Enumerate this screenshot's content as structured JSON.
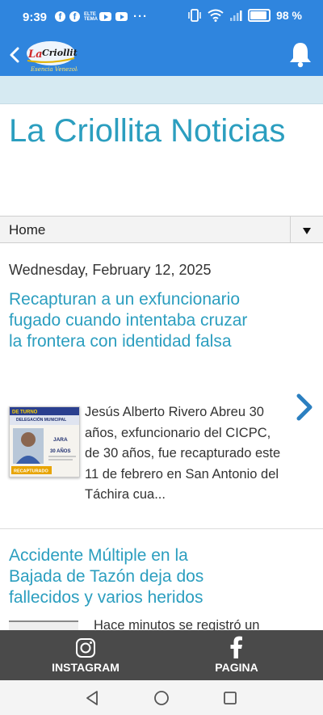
{
  "status_bar": {
    "time": "9:39",
    "tiny_icon_text": "ELTE TEMA",
    "more": "···",
    "battery": "98 %"
  },
  "header": {
    "logo_text": "La Criollita",
    "logo_tagline": "Esencia Venezolana",
    "back_icon": "chevron-left-icon",
    "bell_icon": "bell-icon"
  },
  "blog": {
    "title": "La Criollita Noticias"
  },
  "nav": {
    "home": "Home"
  },
  "posts": {
    "date": "Wednesday, February 12, 2025",
    "items": [
      {
        "title": "Recapturan a un exfuncionario fugado cuando intentaba cruzar la frontera con identidad falsa",
        "snippet": "  Jesús Alberto Rivero Abreu 30 años, exfuncionario del CICPC, de 30 años, fue recapturado este 11 de febrero en San Antonio del Táchira cua...",
        "thumb": {
          "top_label": "DE TURNO",
          "header": "DELEGACIÓN MUNICIPAL",
          "sub": "JARA",
          "age": "30 AÑOS",
          "badge": "RECAPTURADO"
        }
      },
      {
        "title": "Accidente Múltiple en la Bajada de Tazón deja dos fallecidos y varios heridos",
        "snippet": "Hace minutos se registró un"
      }
    ]
  },
  "bottom_bar": {
    "instagram": "INSTAGRAM",
    "pagina": "PAGINA"
  },
  "colors": {
    "brand_blue": "#2f85de",
    "title_teal": "#2b9ebf",
    "band": "#d6eaf2",
    "bottom_bar": "#4a4a4a"
  }
}
